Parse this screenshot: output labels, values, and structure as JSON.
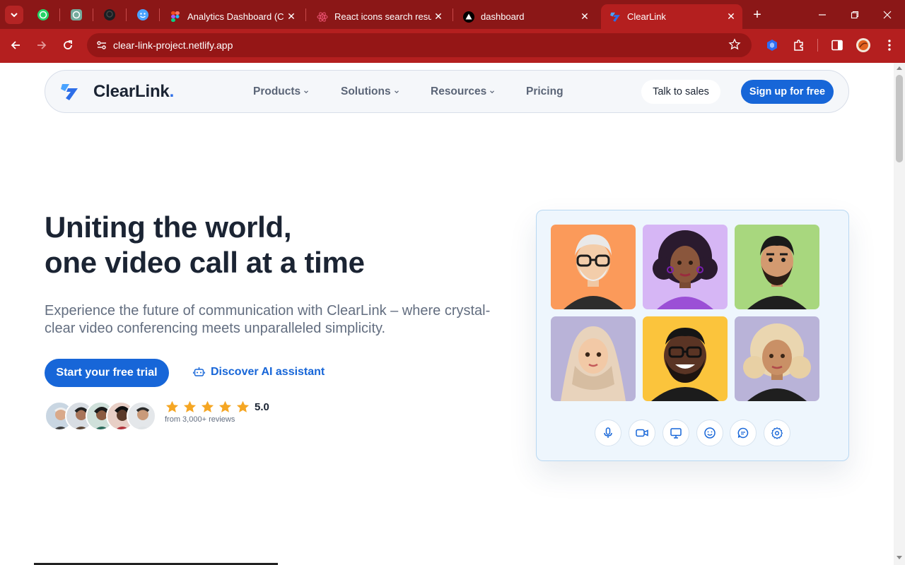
{
  "browser": {
    "tabs": [
      {
        "title": "Analytics Dashboard (Copy)",
        "favicon": "figma-icon"
      },
      {
        "title": "React icons search results",
        "favicon": "react-icon"
      },
      {
        "title": "dashboard",
        "favicon": "vercel-icon"
      },
      {
        "title": "ClearLink",
        "favicon": "clearlink-icon",
        "active": true
      }
    ],
    "pinned_tabs": [
      "whatsapp-icon",
      "chatgpt-icon",
      "github-icon",
      "emoji-icon"
    ],
    "url": "clear-link-project.netlify.app",
    "colors": {
      "frame": "#8b1717",
      "toolbar": "#b41f1f",
      "omnibox": "#951616"
    }
  },
  "nav": {
    "logo_text": "ClearLink",
    "logo_dot": ".",
    "items": [
      {
        "label": "Products",
        "has_dropdown": true
      },
      {
        "label": "Solutions",
        "has_dropdown": true
      },
      {
        "label": "Resources",
        "has_dropdown": true
      },
      {
        "label": "Pricing",
        "has_dropdown": false
      }
    ],
    "talk_to_sales": "Talk to sales",
    "sign_up": "Sign up for free"
  },
  "hero": {
    "title_line1": "Uniting the world,",
    "title_line2": "one video call at a time",
    "subtitle": "Experience the future of communication with ClearLink – where crystal-clear video conferencing meets unparalleled simplicity.",
    "cta": "Start your free trial",
    "ai_link": "Discover AI assistant",
    "rating": {
      "value": "5.0",
      "stars": 5,
      "reviews": "from 3,000+ reviews"
    }
  },
  "call_card": {
    "participants": [
      {
        "name": "participant-1",
        "bg": "#fb9a5a"
      },
      {
        "name": "participant-2",
        "bg": "#d6b6f5"
      },
      {
        "name": "participant-3",
        "bg": "#a8d77e"
      },
      {
        "name": "participant-4",
        "bg": "#b9b3d8"
      },
      {
        "name": "participant-5",
        "bg": "#fbc43c"
      },
      {
        "name": "participant-6",
        "bg": "#b9b3d8"
      }
    ],
    "controls": [
      "microphone-icon",
      "video-camera-icon",
      "screen-share-icon",
      "emoji-icon",
      "chat-icon",
      "settings-icon"
    ]
  },
  "colors": {
    "brand": "#1766d8",
    "heading": "#1b2433",
    "muted": "#636e80",
    "star": "#f5a623"
  }
}
